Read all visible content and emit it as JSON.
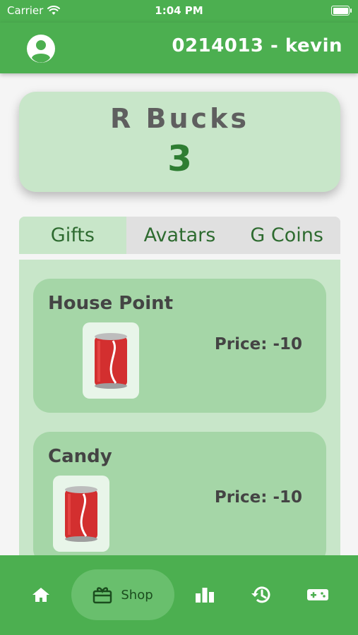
{
  "status_bar": {
    "carrier": "Carrier",
    "time": "1:04 PM"
  },
  "header": {
    "user_label": "0214013 - kevin"
  },
  "balance": {
    "label": "R Bucks",
    "value": "3"
  },
  "tabs": [
    {
      "label": "Gifts",
      "active": true
    },
    {
      "label": "Avatars",
      "active": false
    },
    {
      "label": "G Coins",
      "active": false
    }
  ],
  "items": [
    {
      "name": "House Point",
      "price": "Price: -10",
      "icon": "soda-can-icon"
    },
    {
      "name": "Candy",
      "price": "Price: -10",
      "icon": "soda-can-icon"
    }
  ],
  "bottom_nav": [
    {
      "icon": "home-icon",
      "label": ""
    },
    {
      "icon": "gift-shop-icon",
      "label": "Shop",
      "active": true
    },
    {
      "icon": "bar-chart-icon",
      "label": ""
    },
    {
      "icon": "history-icon",
      "label": ""
    },
    {
      "icon": "gamepad-icon",
      "label": ""
    }
  ],
  "colors": {
    "primary": "#4caf50",
    "card_light": "#c8e6c9",
    "card_item": "#a5d6a7",
    "accent_text": "#2e7d32"
  }
}
